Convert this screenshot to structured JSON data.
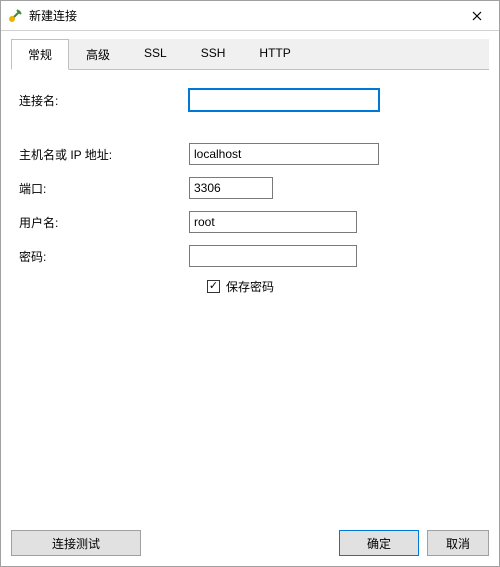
{
  "window": {
    "title": "新建连接"
  },
  "tabs": [
    {
      "label": "常规",
      "active": true
    },
    {
      "label": "高级",
      "active": false
    },
    {
      "label": "SSL",
      "active": false
    },
    {
      "label": "SSH",
      "active": false
    },
    {
      "label": "HTTP",
      "active": false
    }
  ],
  "form": {
    "conn_name_label": "连接名:",
    "conn_name_value": "",
    "host_label": "主机名或 IP 地址:",
    "host_value": "localhost",
    "port_label": "端口:",
    "port_value": "3306",
    "user_label": "用户名:",
    "user_value": "root",
    "password_label": "密码:",
    "password_value": "",
    "save_password_label": "保存密码",
    "save_password_checked": true
  },
  "buttons": {
    "test": "连接测试",
    "ok": "确定",
    "cancel": "取消"
  }
}
